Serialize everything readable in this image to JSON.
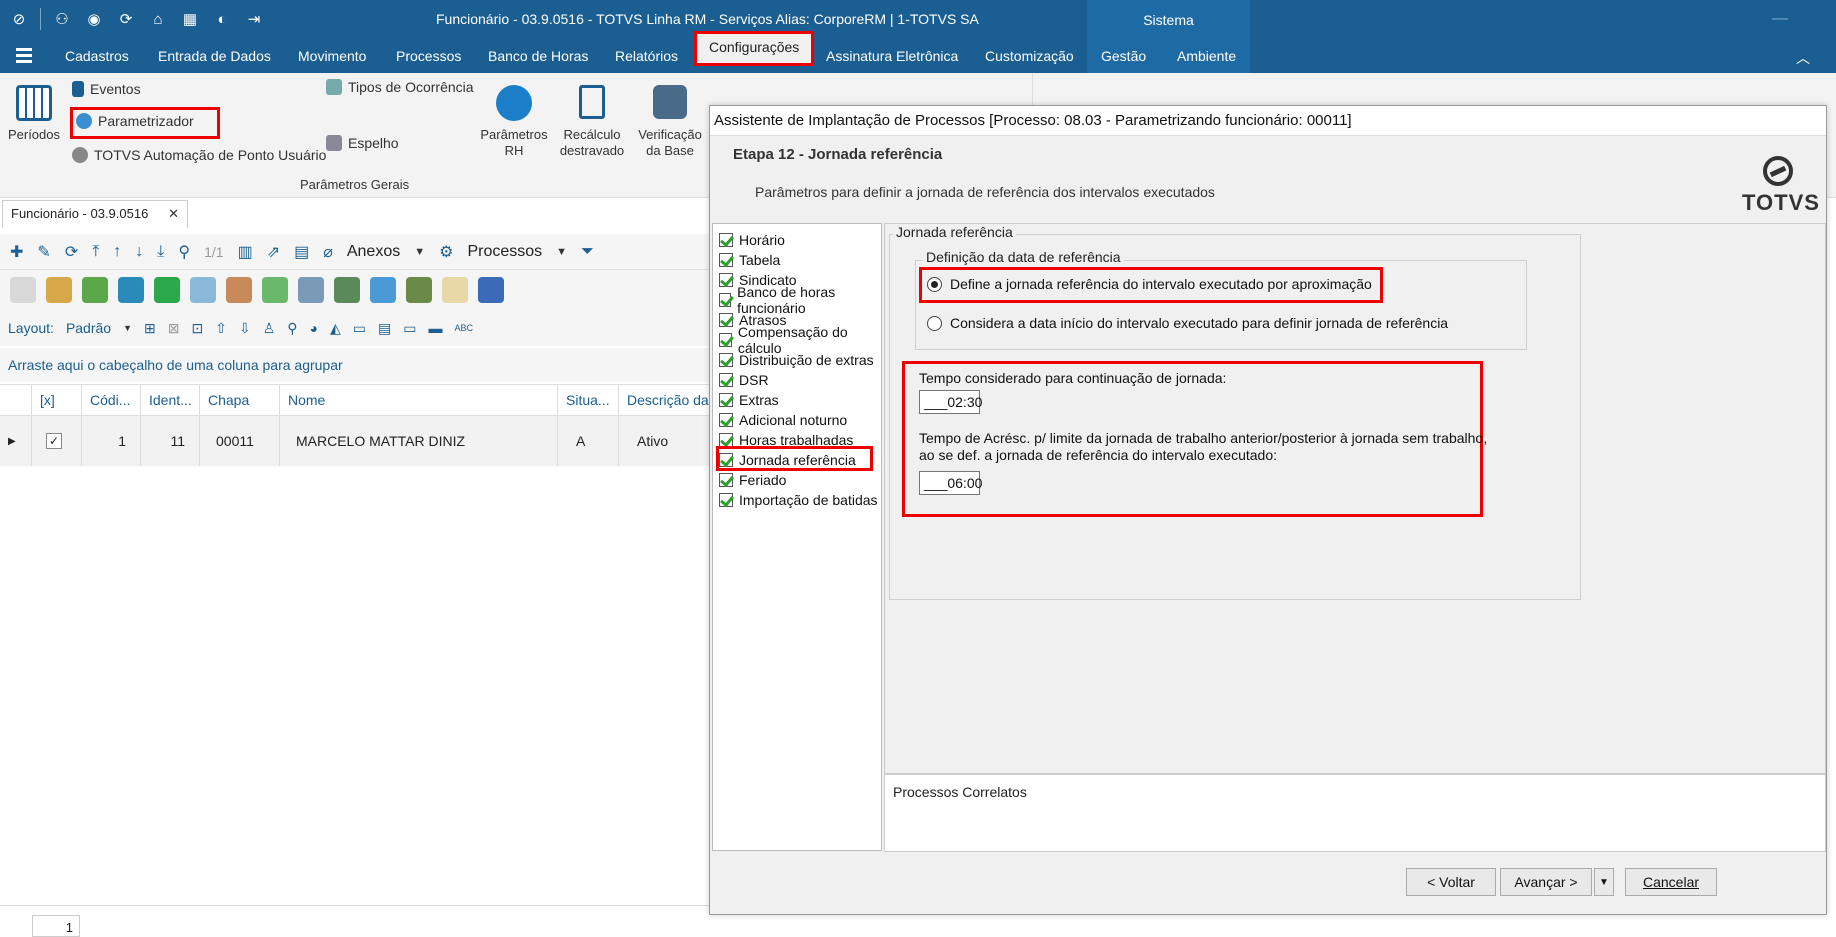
{
  "window": {
    "title": "Funcionário - 03.9.0516 - TOTVS Linha RM - Serviços  Alias: CorporeRM | 1-TOTVS SA",
    "context_tab": "Sistema"
  },
  "menu": {
    "items": [
      "Cadastros",
      "Entrada de Dados",
      "Movimento",
      "Processos",
      "Banco de Horas",
      "Relatórios",
      "Configurações",
      "Assinatura Eletrônica",
      "Customização",
      "Gestão",
      "Ambiente"
    ],
    "active": "Configurações"
  },
  "ribbon": {
    "periodos": "Períodos",
    "eventos": "Eventos",
    "parametrizador": "Parametrizador",
    "automacao": "TOTVS Automação de Ponto Usuário",
    "tipos_ocorrencia": "Tipos de Ocorrência",
    "espelho": "Espelho",
    "parametros_rh": [
      "Parâmetros",
      "RH"
    ],
    "recalculo": [
      "Recálculo",
      "destravado"
    ],
    "verificacao": [
      "Verificação",
      "da Base"
    ],
    "group_label": "Parâmetros Gerais"
  },
  "document": {
    "tab_label": "Funcionário - 03.9.0516",
    "record_counter": "1/1",
    "anexos": "Anexos",
    "processos": "Processos",
    "layout_label": "Layout:",
    "layout_value": "Padrão",
    "group_hint": "Arraste aqui o cabeçalho de uma coluna para agrupar",
    "columns": [
      "[x]",
      "Códi...",
      "Ident...",
      "Chapa",
      "Nome",
      "Situa...",
      "Descrição da"
    ],
    "rows": [
      {
        "codigo": "1",
        "ident": "11",
        "chapa": "00011",
        "nome": "MARCELO MATTAR DINIZ",
        "situacao": "A",
        "descricao": "Ativo"
      }
    ],
    "page": "1"
  },
  "wizard": {
    "title": "Assistente de Implantação de Processos [Processo: 08.03 - Parametrizando funcionário: 00011]",
    "step_title": "Etapa 12 - Jornada referência",
    "step_subtitle": "Parâmetros para definir a jornada de referência dos intervalos executados",
    "logo_text": "TOTVS",
    "steps": [
      "Horário",
      "Tabela",
      "Sindicato",
      "Banco de horas funcionário",
      "Atrasos",
      "Compensação do cálculo",
      "Distribuição de extras",
      "DSR",
      "Extras",
      "Adicional noturno",
      "Horas trabalhadas",
      "Jornada referência",
      "Feriado",
      "Importação de batidas"
    ],
    "active_step": "Jornada referência",
    "group_title": "Jornada referência",
    "subgroup_title": "Definição da data de referência",
    "option_1": "Define a jornada referência do intervalo executado por aproximação",
    "option_2": "Considera a data início do intervalo executado para definir jornada de referência",
    "selected_option": 1,
    "field_1_label": "Tempo considerado para continuação de jornada:",
    "field_1_value": "___02:30",
    "field_2_label_line1": "Tempo de Acrésc. p/ limite da jornada de trabalho anterior/posterior à jornada sem trabalho,",
    "field_2_label_line2": "ao se def. a jornada de referência do intervalo executado:",
    "field_2_value": "___06:00",
    "correlatos": "Processos Correlatos",
    "btn_back": "< Voltar",
    "btn_next": "Avançar >",
    "btn_cancel": "Cancelar"
  },
  "colors": {
    "titlebar": "#1a5e92",
    "highlight": "#ee0000",
    "link": "#1a5e92"
  }
}
